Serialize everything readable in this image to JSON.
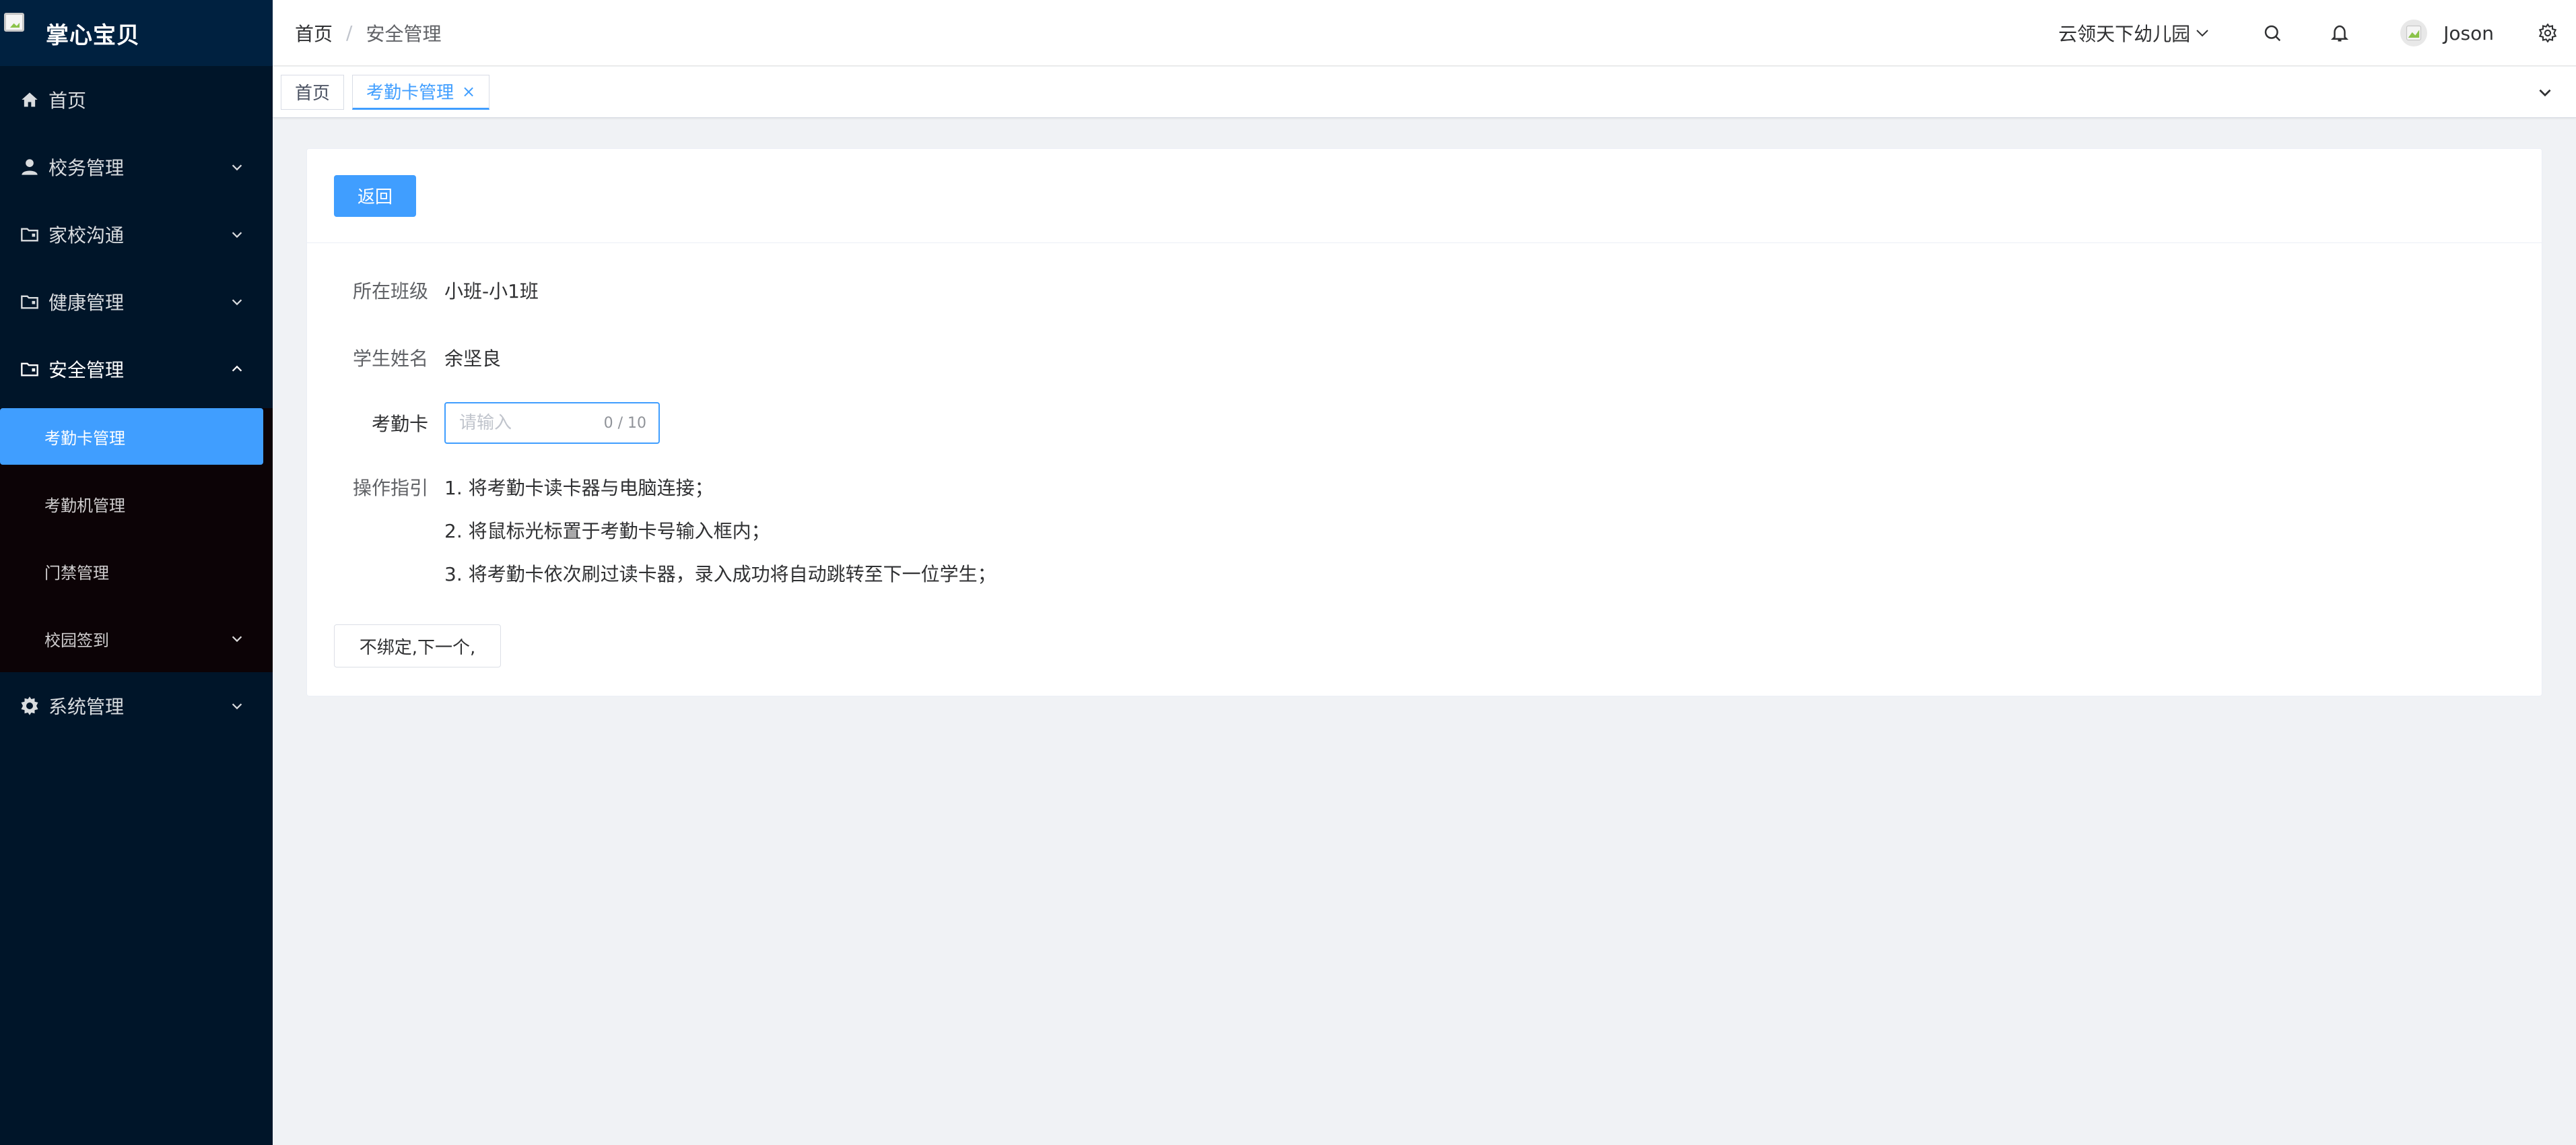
{
  "app": {
    "name": "掌心宝贝"
  },
  "sidebar": {
    "items": [
      {
        "label": "首页",
        "icon": "home-icon"
      },
      {
        "label": "校务管理",
        "icon": "user-icon"
      },
      {
        "label": "家校沟通",
        "icon": "folder-icon"
      },
      {
        "label": "健康管理",
        "icon": "folder-icon"
      },
      {
        "label": "安全管理",
        "icon": "folder-icon"
      },
      {
        "label": "系统管理",
        "icon": "gear-icon"
      }
    ],
    "security_submenu": [
      {
        "label": "考勤卡管理",
        "active": true
      },
      {
        "label": "考勤机管理"
      },
      {
        "label": "门禁管理"
      },
      {
        "label": "校园签到"
      }
    ]
  },
  "header": {
    "breadcrumb": [
      "首页",
      "安全管理"
    ],
    "breadcrumb_separator": "/",
    "school": "云领天下幼儿园",
    "username": "Joson"
  },
  "tags": [
    {
      "label": "首页"
    },
    {
      "label": "考勤卡管理",
      "active": true,
      "close": "×"
    }
  ],
  "page": {
    "back_button": "返回",
    "class_label": "所在班级",
    "class_value": "小班-小1班",
    "student_label": "学生姓名",
    "student_value": "余坚良",
    "card_label": "考勤卡",
    "card_input": {
      "value": "",
      "placeholder": "请输入",
      "count": "0 / 10"
    },
    "guide_label": "操作指引",
    "guide_lines": [
      "1. 将考勤卡读卡器与电脑连接；",
      "2. 将鼠标光标置于考勤卡号输入框内；",
      "3. 将考勤卡依次刷过读卡器，录入成功将自动跳转至下一位学生；"
    ],
    "skip_button": "不绑定,下一个,"
  },
  "colors": {
    "sidebar_bg": "#001529",
    "submenu_bg": "#0c0306",
    "primary": "#409eff",
    "page_bg": "#f0f2f5"
  }
}
